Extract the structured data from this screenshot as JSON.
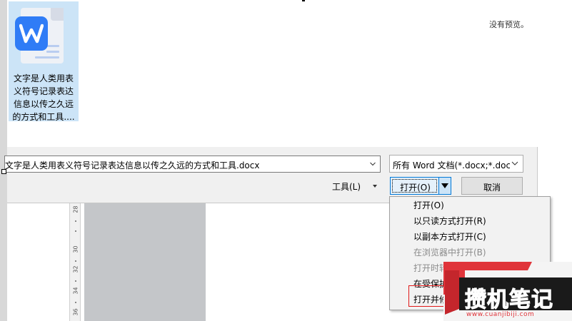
{
  "dialog": {
    "preview_text": "没有预览。",
    "file_item": {
      "label": "文字是人类用表义符号记录表达信息以传之久远的方式和工具....",
      "icon": "wps-word-document-icon"
    },
    "filename_value": "文字是人类用表义符号记录表达信息以传之久远的方式和工具.docx",
    "file_type_value": "所有 Word 文档(*.docx;*.docx",
    "tools_label": "工具(L)",
    "open_label": "打开(O)",
    "cancel_label": "取消"
  },
  "menu": {
    "items": [
      {
        "label": "打开(O)",
        "enabled": true
      },
      {
        "label": "以只读方式打开(R)",
        "enabled": true
      },
      {
        "label": "以副本方式打开(C)",
        "enabled": true
      },
      {
        "label": "在浏览器中打开(B)",
        "enabled": false
      },
      {
        "label": "打开时转",
        "enabled": false
      },
      {
        "label": "在受保护",
        "enabled": true
      },
      {
        "label": "打开并修",
        "enabled": true
      }
    ]
  },
  "ruler": {
    "ticks": [
      "28",
      "30",
      "32",
      "34",
      "36"
    ]
  },
  "watermark": {
    "title": "攒机笔记",
    "url": "www.cuanjibiji.com",
    "accent": "#e0343a"
  },
  "colors": {
    "word_blue": "#2f7cf6",
    "selection": "#cce4f7",
    "focus": "#0078d7"
  }
}
